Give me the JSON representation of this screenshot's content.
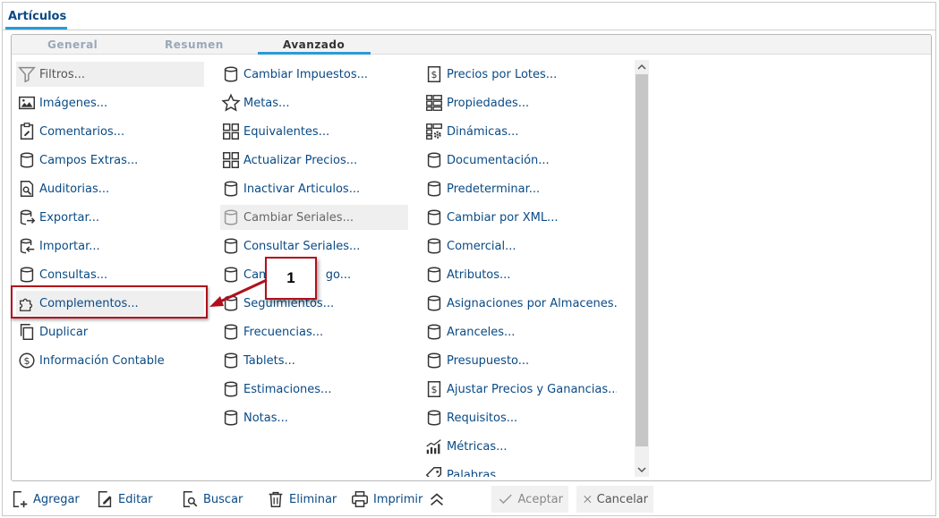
{
  "window": {
    "tab_label": "Artículos"
  },
  "subtabs": [
    {
      "label": "General"
    },
    {
      "label": "Resumen"
    },
    {
      "label": "Avanzado"
    }
  ],
  "columns": {
    "col1": [
      {
        "label": "Filtros...",
        "icon": "filter-icon"
      },
      {
        "label": "Imágenes...",
        "icon": "image-icon"
      },
      {
        "label": "Comentarios...",
        "icon": "clipboard-edit-icon"
      },
      {
        "label": "Campos Extras...",
        "icon": "database-icon"
      },
      {
        "label": "Auditorias...",
        "icon": "document-search-icon"
      },
      {
        "label": "Exportar...",
        "icon": "database-export-icon"
      },
      {
        "label": "Importar...",
        "icon": "database-import-icon"
      },
      {
        "label": "Consultas...",
        "icon": "database-icon"
      },
      {
        "label": "Complementos...",
        "icon": "puzzle-icon"
      },
      {
        "label": "Duplicar",
        "icon": "copy-icon"
      },
      {
        "label": "Información Contable",
        "icon": "dollar-circle-icon"
      }
    ],
    "col2": [
      {
        "label": "Cambiar Impuestos...",
        "icon": "database-icon"
      },
      {
        "label": "Metas...",
        "icon": "star-icon"
      },
      {
        "label": "Equivalentes...",
        "icon": "grid-icon"
      },
      {
        "label": "Actualizar Precios...",
        "icon": "grid-icon"
      },
      {
        "label": "Inactivar Articulos...",
        "icon": "database-icon"
      },
      {
        "label": "Cambiar Seriales...",
        "icon": "database-icon"
      },
      {
        "label": "Consultar Seriales...",
        "icon": "database-icon"
      },
      {
        "label": "Cam",
        "label_tail": "go...",
        "icon": "database-icon"
      },
      {
        "label": "Seguimientos...",
        "icon": "database-icon"
      },
      {
        "label": "Frecuencias...",
        "icon": "database-icon"
      },
      {
        "label": "Tablets...",
        "icon": "database-icon"
      },
      {
        "label": "Estimaciones...",
        "icon": "database-icon"
      },
      {
        "label": "Notas...",
        "icon": "database-icon"
      }
    ],
    "col3": [
      {
        "label": "Precios por Lotes...",
        "icon": "dollar-doc-icon"
      },
      {
        "label": "Propiedades...",
        "icon": "list-grid-icon"
      },
      {
        "label": "Dinámicas...",
        "icon": "grid-gear-icon"
      },
      {
        "label": "Documentación...",
        "icon": "database-icon"
      },
      {
        "label": "Predeterminar...",
        "icon": "database-icon"
      },
      {
        "label": "Cambiar por XML...",
        "icon": "database-icon"
      },
      {
        "label": "Comercial...",
        "icon": "database-icon"
      },
      {
        "label": "Atributos...",
        "icon": "database-icon"
      },
      {
        "label": "Asignaciones por Almacenes...",
        "icon": "database-icon"
      },
      {
        "label": "Aranceles...",
        "icon": "database-icon"
      },
      {
        "label": "Presupuesto...",
        "icon": "database-icon"
      },
      {
        "label": "Ajustar Precios y Ganancias...",
        "icon": "dollar-doc-icon"
      },
      {
        "label": "Requisitos...",
        "icon": "database-icon"
      },
      {
        "label": "Métricas...",
        "icon": "chart-bars-icon"
      },
      {
        "label": "Palabras...",
        "icon": "tag-icon"
      }
    ]
  },
  "bottombar": {
    "agregar": "Agregar",
    "editar": "Editar",
    "buscar": "Buscar",
    "eliminar": "Eliminar",
    "imprimir": "Imprimir",
    "aceptar": "Aceptar",
    "cancelar": "Cancelar"
  },
  "annotation": {
    "callout_number": "1"
  },
  "colors": {
    "link": "#0a4a85",
    "accent": "#2a9ad6",
    "annotation_red": "#b0101c"
  }
}
